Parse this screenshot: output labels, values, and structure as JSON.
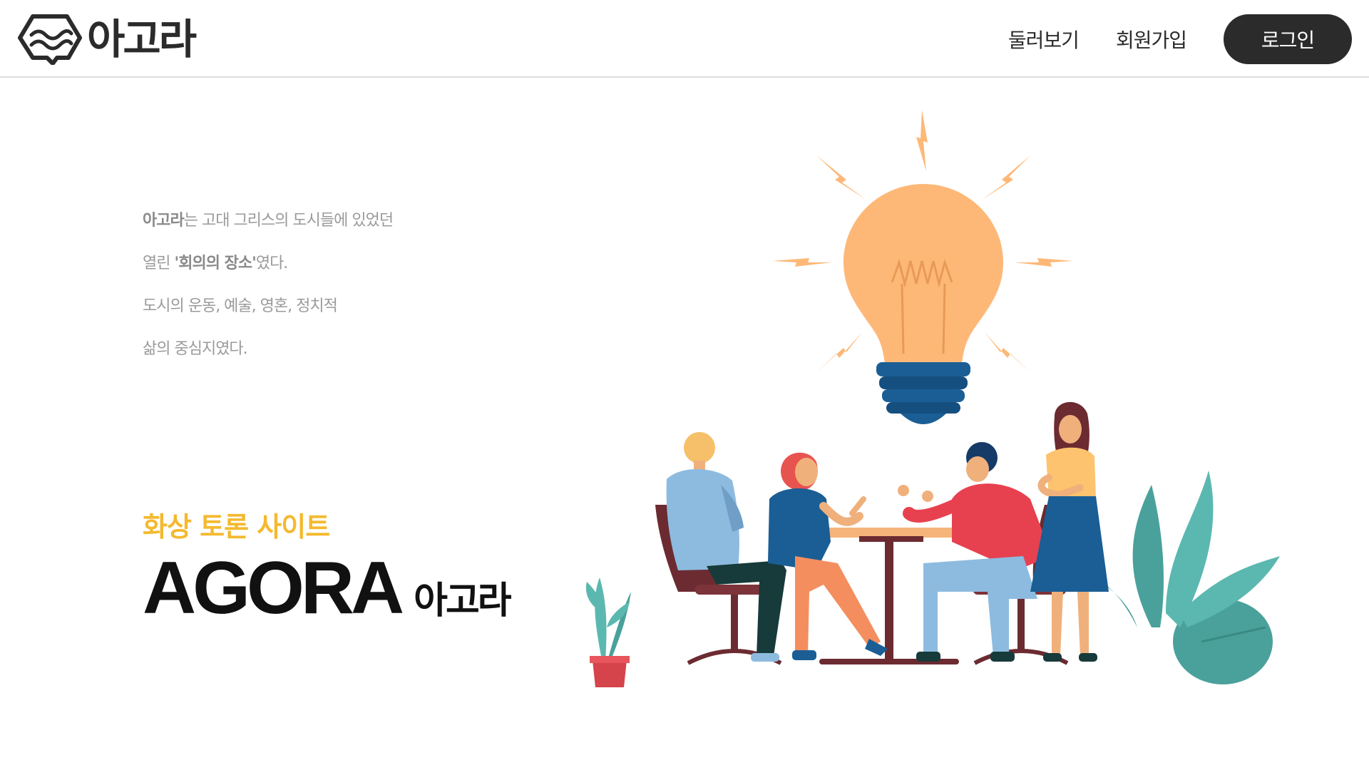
{
  "header": {
    "logo_text": "아고라",
    "nav": [
      "둘러보기",
      "회원가입"
    ],
    "login_label": "로그인"
  },
  "intro": {
    "line1_bold": "아고라",
    "line1_rest": "는 고대 그리스의 도시들에 있었던",
    "line2_pre": "열린 ",
    "line2_bold": "'회의의 장소'",
    "line2_post": "였다.",
    "line3": "도시의 운동, 예술, 영혼, 정치적",
    "line4": "삶의 중심지였다."
  },
  "hero": {
    "subtitle": "화상 토론 사이트",
    "title_en": "AGORA",
    "title_ko": "아고라"
  },
  "colors": {
    "accent_yellow": "#f4b92f",
    "dark": "#2b2b2b",
    "bulb": "#fdb878",
    "bulb_base": "#1a5e95"
  }
}
